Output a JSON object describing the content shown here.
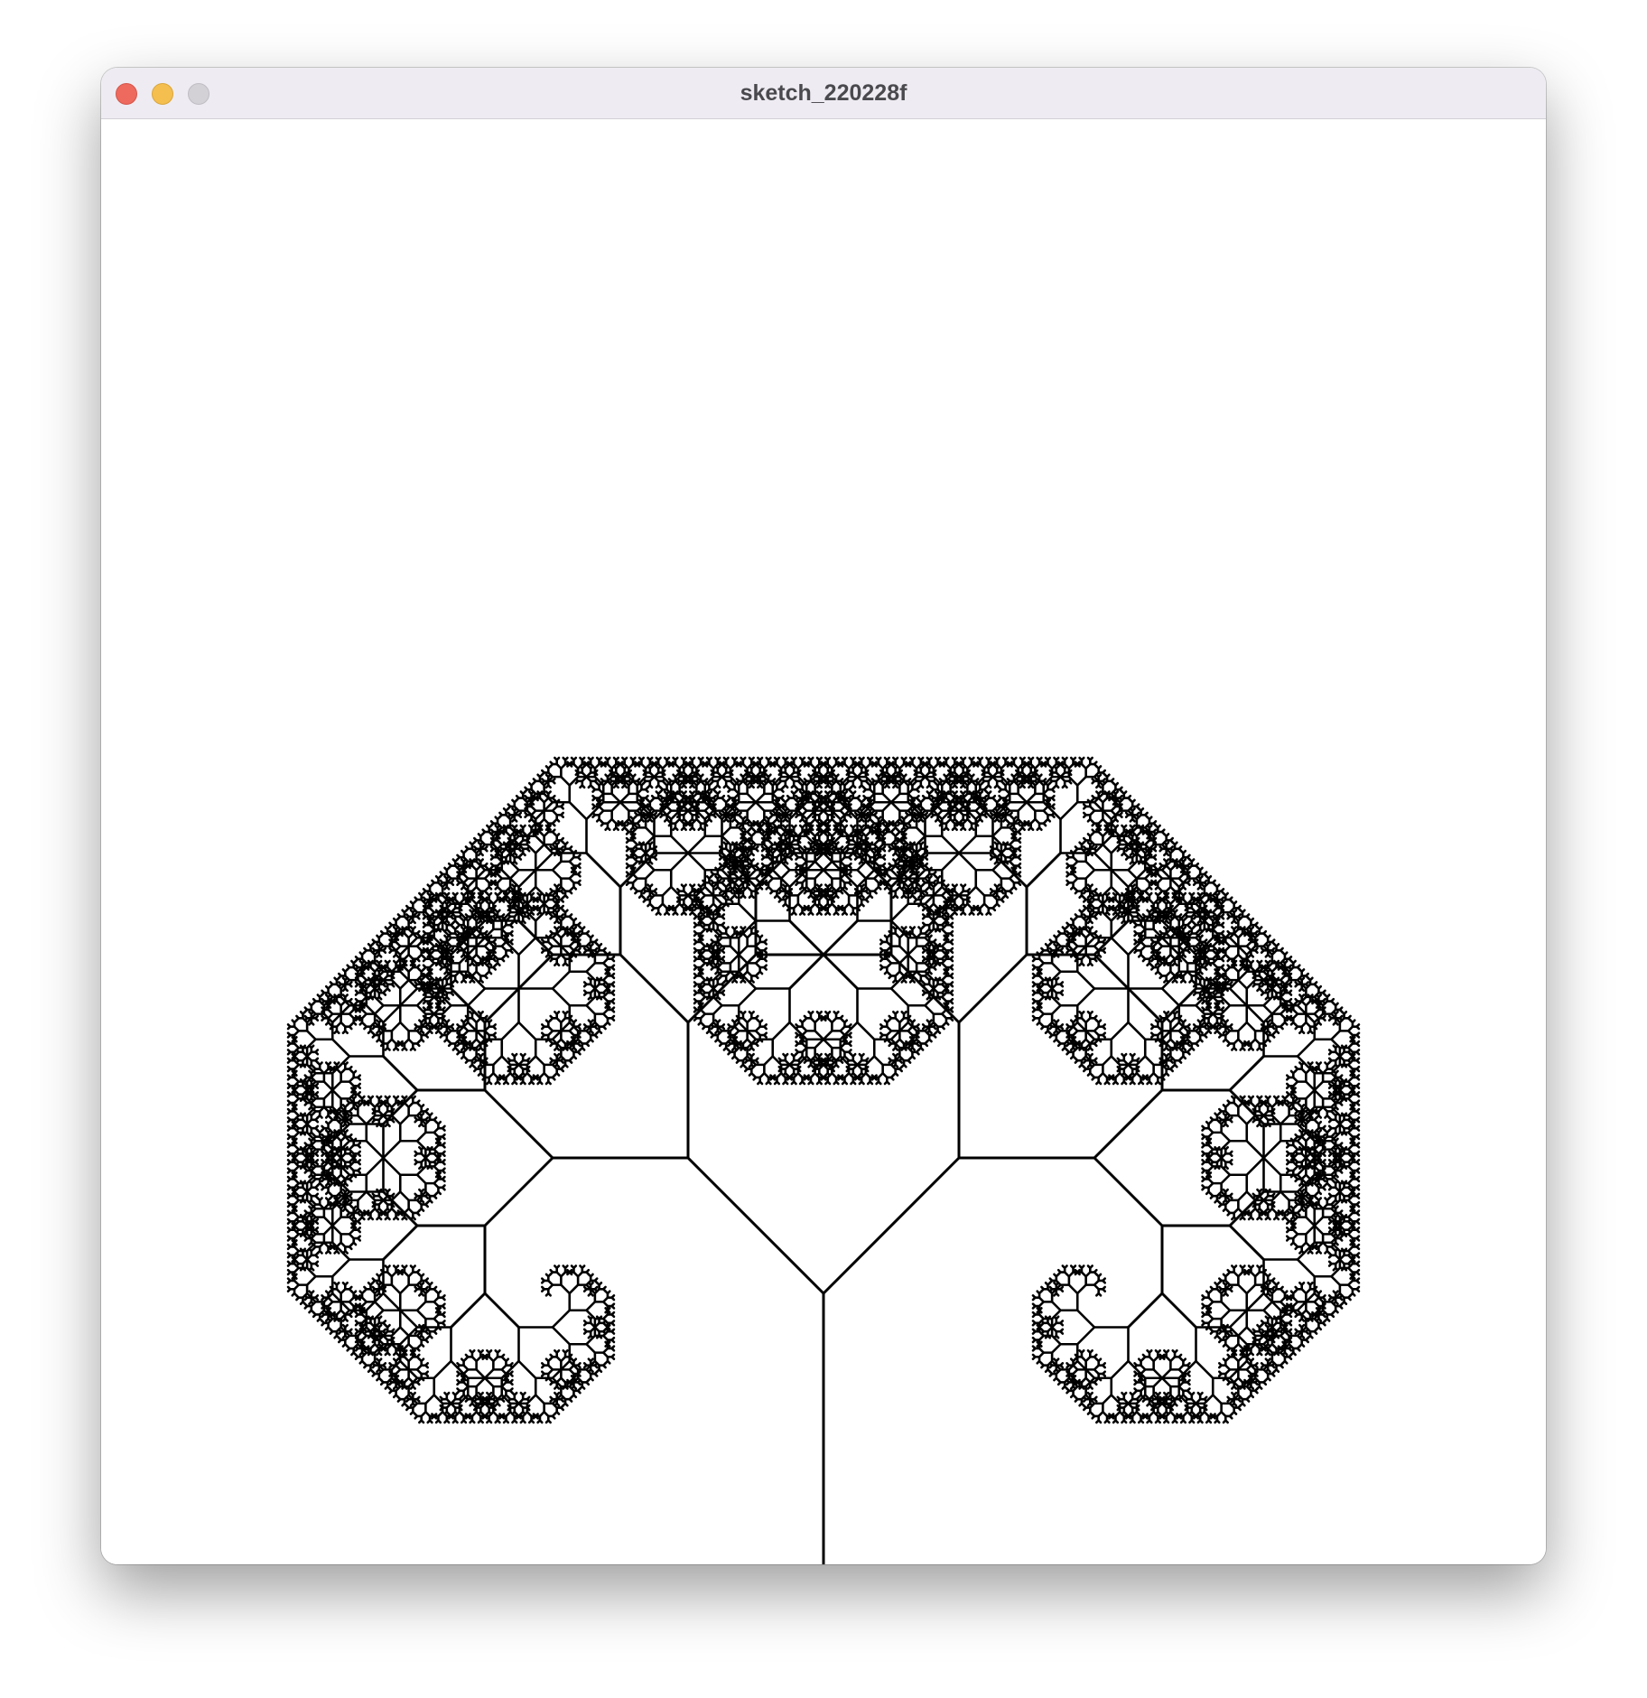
{
  "window": {
    "title": "sketch_220228f"
  },
  "titlebar": {
    "buttons": [
      {
        "name": "close-button",
        "icon": "close-circle-icon",
        "color": "#ee6a5e"
      },
      {
        "name": "minimize-button",
        "icon": "minimize-circle-icon",
        "color": "#f5bf4f"
      },
      {
        "name": "zoom-button",
        "icon": "zoom-circle-icon",
        "color": "#d3d1d6"
      }
    ]
  },
  "canvas": {
    "background": "#ffffff",
    "stroke": "#000000",
    "drawing": "fractal-tree"
  }
}
